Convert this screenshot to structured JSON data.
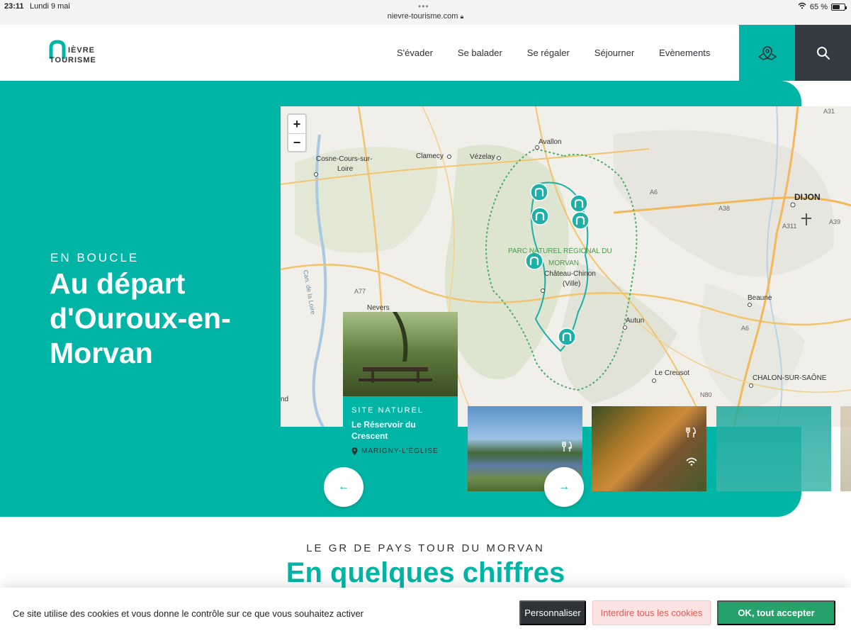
{
  "status_bar": {
    "time": "23:11",
    "date": "Lundi 9 mai",
    "url": "nievre-tourisme.com",
    "battery": "65 %",
    "battery_level": 0.65
  },
  "header": {
    "logo_line1": "IÈVRE",
    "logo_line2": "TOURISME",
    "nav": [
      "S'évader",
      "Se balader",
      "Se régaler",
      "Séjourner",
      "Evènements"
    ],
    "map_icon": "map-pin-icon",
    "search_icon": "search-icon"
  },
  "hero": {
    "kicker": "EN BOUCLE",
    "title": "Au départ d'Ouroux-en-Morvan"
  },
  "map": {
    "zoom_in": "+",
    "zoom_out": "−",
    "labels": [
      "Cosne-Cours-sur-",
      "Loire",
      "Clamecy",
      "Vézelay",
      "Avallon",
      "DIJON",
      "A6",
      "A38",
      "A311",
      "A39",
      "A31",
      "PARC NATUREL RÉGIONAL DU",
      "MORVAN",
      "Château-Chinon",
      "(Ville)",
      "Can. de la Loire",
      "A77",
      "Nevers",
      "Beaune",
      "Autun",
      "A6",
      "Le Creusot",
      "N80",
      "CHALON-SUR-SAÔNE",
      "nd"
    ]
  },
  "cards": {
    "main": {
      "type": "SITE NATUREL",
      "name": "Le Réservoir du Crescent",
      "place": "MARIGNY-L'ÉGLISE"
    },
    "prev": "←",
    "next": "→"
  },
  "section": {
    "kicker": "LE GR DE PAYS TOUR DU MORVAN",
    "title": "En quelques chiffres"
  },
  "cookie": {
    "text": "Ce site utilise des cookies et vous donne le contrôle sur ce que vous souhaitez activer",
    "personalize": "Personnaliser",
    "deny": "Interdire tous les cookies",
    "accept": "OK, tout accepter"
  },
  "colors": {
    "brand_teal": "#00b5a5",
    "dark": "#333b42",
    "accept_green": "#25a36b"
  }
}
